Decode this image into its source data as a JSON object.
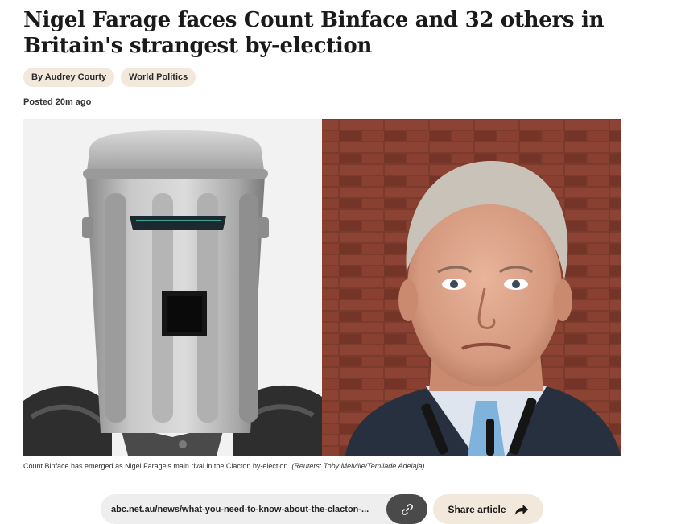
{
  "article": {
    "headline": "Nigel Farage faces Count Binface and 32 others in Britain's strangest by-election",
    "tags": [
      "By Audrey Courty",
      "World Politics"
    ],
    "posted": "Posted 20m ago"
  },
  "image": {
    "caption": "Count Binface has emerged as Nigel Farage's main rival in the Clacton by-election.",
    "credit": "(Reuters: Toby Melville/Temilade Adelaja)"
  },
  "share": {
    "url": "abc.net.au/news/what-you-need-to-know-about-the-clacton-...",
    "copy_icon": "link-icon",
    "share_label": "Share article",
    "share_icon": "share-arrow-icon"
  },
  "colors": {
    "tag_bg": "#f3e8dc",
    "copy_button_bg": "#4a4a4a",
    "url_bar_bg": "#eeeeee"
  }
}
